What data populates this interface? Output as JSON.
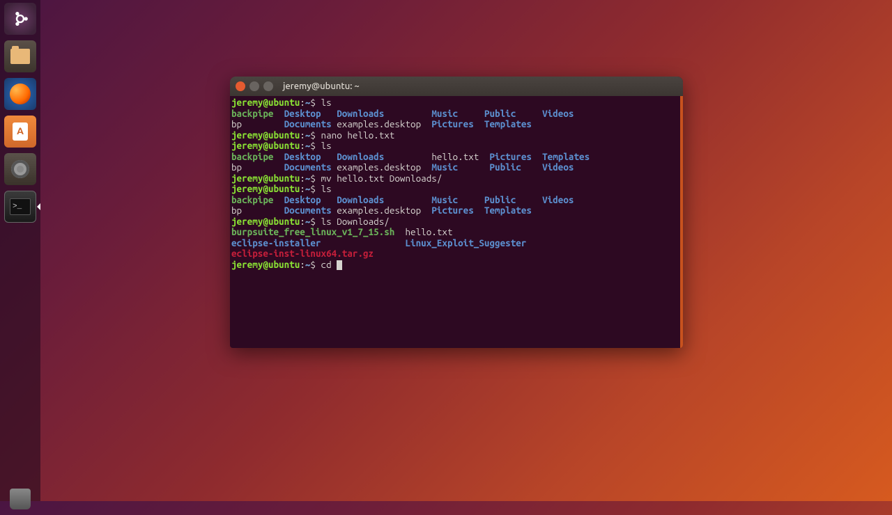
{
  "launcher": {
    "items": [
      {
        "name": "dash-icon"
      },
      {
        "name": "files-icon"
      },
      {
        "name": "firefox-icon"
      },
      {
        "name": "software-center-icon"
      },
      {
        "name": "settings-icon"
      },
      {
        "name": "terminal-icon"
      }
    ],
    "bottom": {
      "name": "trash-icon"
    }
  },
  "terminal": {
    "title": "jeremy@ubuntu: ~",
    "prompt": {
      "userhost": "jeremy@ubuntu",
      "sep": ":",
      "path": "~",
      "sigil": "$"
    },
    "lines": [
      {
        "type": "cmd",
        "text": "ls"
      },
      {
        "type": "ls",
        "cols": [
          [
            "backpipe",
            "exe"
          ],
          [
            "Desktop",
            "dir"
          ],
          [
            "Downloads",
            "dir"
          ],
          [
            "Music",
            "dir"
          ],
          [
            "Public",
            "dir"
          ],
          [
            "Videos",
            "dir"
          ],
          [
            "bp",
            "file"
          ],
          [
            "Documents",
            "dir"
          ],
          [
            "examples.desktop",
            "file"
          ],
          [
            "Pictures",
            "dir"
          ],
          [
            "Templates",
            "dir"
          ]
        ],
        "breakAt": 6
      },
      {
        "type": "cmd",
        "text": "nano hello.txt"
      },
      {
        "type": "cmd",
        "text": "ls"
      },
      {
        "type": "ls",
        "cols": [
          [
            "backpipe",
            "exe"
          ],
          [
            "Desktop",
            "dir"
          ],
          [
            "Downloads",
            "dir"
          ],
          [
            "hello.txt",
            "file"
          ],
          [
            "Pictures",
            "dir"
          ],
          [
            "Templates",
            "dir"
          ],
          [
            "bp",
            "file"
          ],
          [
            "Documents",
            "dir"
          ],
          [
            "examples.desktop",
            "file"
          ],
          [
            "Music",
            "dir"
          ],
          [
            "Public",
            "dir"
          ],
          [
            "Videos",
            "dir"
          ]
        ],
        "breakAt": 6
      },
      {
        "type": "cmd",
        "text": "mv hello.txt Downloads/"
      },
      {
        "type": "cmd",
        "text": "ls"
      },
      {
        "type": "ls",
        "cols": [
          [
            "backpipe",
            "exe"
          ],
          [
            "Desktop",
            "dir"
          ],
          [
            "Downloads",
            "dir"
          ],
          [
            "Music",
            "dir"
          ],
          [
            "Public",
            "dir"
          ],
          [
            "Videos",
            "dir"
          ],
          [
            "bp",
            "file"
          ],
          [
            "Documents",
            "dir"
          ],
          [
            "examples.desktop",
            "file"
          ],
          [
            "Pictures",
            "dir"
          ],
          [
            "Templates",
            "dir"
          ]
        ],
        "breakAt": 6
      },
      {
        "type": "cmd",
        "text": "ls Downloads/"
      },
      {
        "type": "ls-downloads",
        "rows": [
          [
            [
              "burpsuite_free_linux_v1_7_15.sh",
              "exe"
            ],
            [
              "hello.txt",
              "file"
            ]
          ],
          [
            [
              "eclipse-installer",
              "dir"
            ],
            [
              "Linux_Exploit_Suggester",
              "dir"
            ]
          ],
          [
            [
              "eclipse-inst-linux64.tar.gz",
              "arch"
            ]
          ]
        ]
      },
      {
        "type": "cmd-cursor",
        "text": "cd "
      }
    ],
    "colwidths_a": [
      10,
      10,
      18,
      10,
      11,
      0
    ],
    "colwidths_b": [
      10,
      10,
      18,
      11,
      10,
      0
    ],
    "colwidths_dl": [
      33,
      0
    ]
  }
}
